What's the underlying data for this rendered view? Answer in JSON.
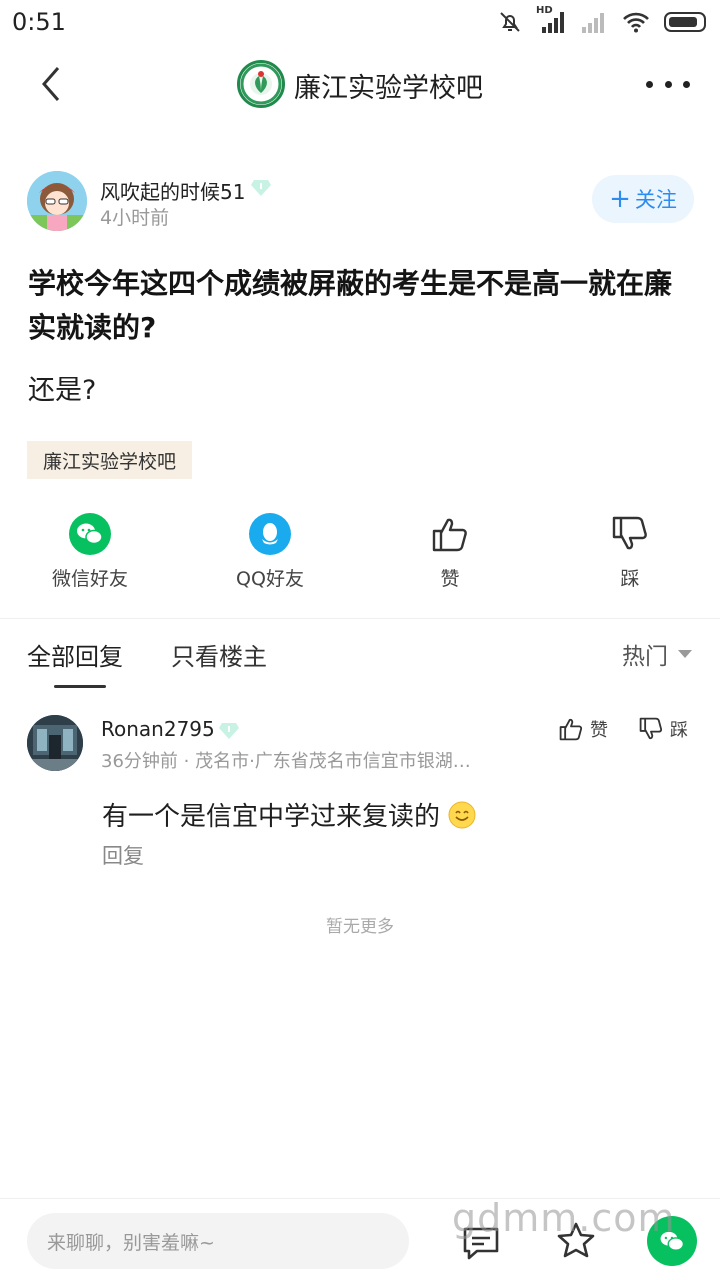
{
  "status_bar": {
    "time": "0:51",
    "network_label": "HD"
  },
  "nav": {
    "title": "廉江实验学校吧",
    "logo_icon": "school-emblem-icon"
  },
  "post": {
    "author": "风吹起的时候51",
    "time": "4小时前",
    "follow_label": "关注",
    "title": "学校今年这四个成绩被屏蔽的考生是不是高一就在廉实就读的?",
    "content": "还是?",
    "forum_tag": "廉江实验学校吧"
  },
  "actions": [
    {
      "label": "微信好友",
      "icon": "wechat-icon",
      "color": "#07c160"
    },
    {
      "label": "QQ好友",
      "icon": "qq-icon",
      "color": "#1aabee"
    },
    {
      "label": "赞",
      "icon": "thumbs-up-icon"
    },
    {
      "label": "踩",
      "icon": "thumbs-down-icon"
    }
  ],
  "tabs": {
    "all": "全部回复",
    "host_only": "只看楼主",
    "sort": "热门"
  },
  "comment": {
    "author": "Ronan2795",
    "meta": "36分钟前 · 茂名市·广东省茂名市信宜市银湖…",
    "like_label": "赞",
    "dislike_label": "踩",
    "text": "有一个是信宜中学过来复读的",
    "reply_label": "回复"
  },
  "no_more": "暂无更多",
  "bottom_bar": {
    "input_placeholder": "来聊聊，别害羞嘛~",
    "watermark": "gdmm.com"
  },
  "colors": {
    "accent_blue": "#2d8cf0",
    "wechat_green": "#07c160",
    "qq_blue": "#1aabee",
    "tag_bg": "#f7efe3"
  }
}
